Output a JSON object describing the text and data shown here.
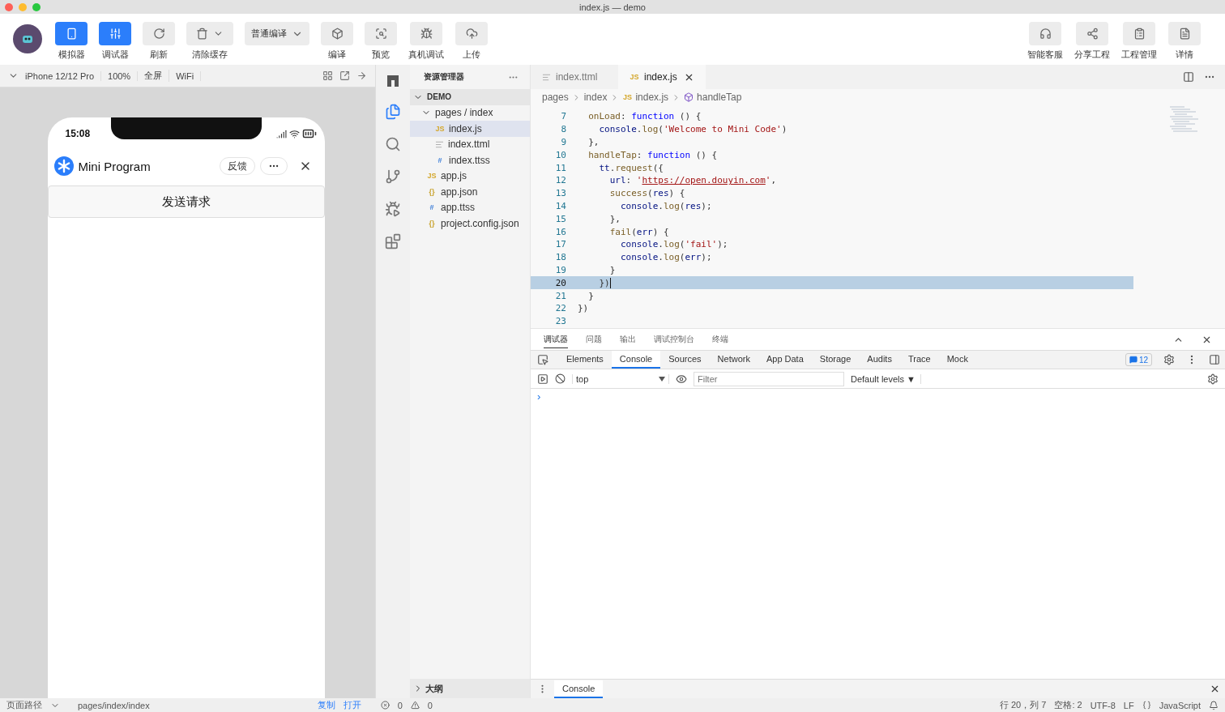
{
  "window": {
    "title": "index.js — demo"
  },
  "toolbar": {
    "left": [
      {
        "label": "模拟器",
        "active": true
      },
      {
        "label": "调试器",
        "active": true
      },
      {
        "label": "刷新",
        "active": false
      },
      {
        "label": "清除缓存",
        "active": false,
        "dropdown": true
      },
      {
        "kind": "select",
        "label": "普通编译"
      },
      {
        "label": "编译",
        "active": false
      },
      {
        "label": "预览",
        "active": false
      },
      {
        "label": "真机调试",
        "active": false
      },
      {
        "label": "上传",
        "active": false
      }
    ],
    "right": [
      {
        "label": "智能客服"
      },
      {
        "label": "分享工程"
      },
      {
        "label": "工程管理"
      },
      {
        "label": "详情"
      }
    ]
  },
  "device_bar": {
    "device": "iPhone 12/12 Pro",
    "zoom": "100%",
    "mode": "全屏",
    "network": "WiFi"
  },
  "phone": {
    "time": "15:08",
    "app_name": "Mini Program",
    "feedback": "反馈",
    "button": "发送请求"
  },
  "explorer": {
    "title": "资源管理器",
    "root": {
      "label": "DEMO",
      "expanded": true,
      "children": [
        {
          "label": "pages / index",
          "kind": "folder",
          "expanded": true,
          "children": [
            {
              "label": "index.js",
              "kind": "js",
              "glyph": "JS",
              "selected": true
            },
            {
              "label": "index.ttml",
              "kind": "ttml",
              "selected": false
            },
            {
              "label": "index.ttss",
              "kind": "ttss",
              "glyph": "#",
              "selected": false
            }
          ]
        },
        {
          "label": "app.js",
          "kind": "js",
          "glyph": "JS",
          "selected": false
        },
        {
          "label": "app.json",
          "kind": "json",
          "glyph": "{}",
          "selected": false
        },
        {
          "label": "app.ttss",
          "kind": "ttss",
          "glyph": "#",
          "selected": false
        },
        {
          "label": "project.config.json",
          "kind": "json",
          "glyph": "{}",
          "selected": false
        }
      ]
    },
    "outline": {
      "label": "大纲",
      "expanded": false
    }
  },
  "editor": {
    "tabs": [
      {
        "label": "index.ttml",
        "kind": "ttml",
        "selected": false
      },
      {
        "label": "index.js",
        "kind": "js",
        "glyph": "JS",
        "selected": true
      }
    ],
    "breadcrumbs": [
      {
        "label": "pages"
      },
      {
        "label": "index"
      },
      {
        "label": "index.js",
        "glyph": "JS"
      },
      {
        "label": "handleTap"
      }
    ],
    "lines": [
      {
        "number": "7",
        "selected": false,
        "tokens": [
          {
            "text": "  onLoad",
            "kind": "fn"
          },
          {
            "text": ": ",
            "kind": "p"
          },
          {
            "text": "function",
            "kind": "kw"
          },
          {
            "text": " () {",
            "kind": "p"
          }
        ]
      },
      {
        "number": "8",
        "selected": false,
        "tokens": [
          {
            "text": "    console",
            "kind": "var"
          },
          {
            "text": ".",
            "kind": "p"
          },
          {
            "text": "log",
            "kind": "fn"
          },
          {
            "text": "(",
            "kind": "p"
          },
          {
            "text": "'Welcome to Mini Code'",
            "kind": "str"
          },
          {
            "text": ")",
            "kind": "p"
          }
        ]
      },
      {
        "number": "9",
        "selected": false,
        "tokens": [
          {
            "text": "  },",
            "kind": "p"
          }
        ]
      },
      {
        "number": "10",
        "selected": false,
        "tokens": [
          {
            "text": "  handleTap",
            "kind": "fn"
          },
          {
            "text": ": ",
            "kind": "p"
          },
          {
            "text": "function",
            "kind": "kw"
          },
          {
            "text": " () {",
            "kind": "p"
          }
        ]
      },
      {
        "number": "11",
        "selected": false,
        "tokens": [
          {
            "text": "    tt",
            "kind": "var"
          },
          {
            "text": ".",
            "kind": "p"
          },
          {
            "text": "request",
            "kind": "fn"
          },
          {
            "text": "({",
            "kind": "p"
          }
        ]
      },
      {
        "number": "12",
        "selected": false,
        "tokens": [
          {
            "text": "      url",
            "kind": "var"
          },
          {
            "text": ": ",
            "kind": "p"
          },
          {
            "text": "'",
            "kind": "str"
          },
          {
            "text": "https://open.douyin.com",
            "kind": "url"
          },
          {
            "text": "'",
            "kind": "str"
          },
          {
            "text": ",",
            "kind": "p"
          }
        ]
      },
      {
        "number": "13",
        "selected": false,
        "tokens": [
          {
            "text": "      success",
            "kind": "fn"
          },
          {
            "text": "(",
            "kind": "p"
          },
          {
            "text": "res",
            "kind": "var"
          },
          {
            "text": ") {",
            "kind": "p"
          }
        ]
      },
      {
        "number": "14",
        "selected": false,
        "tokens": [
          {
            "text": "        console",
            "kind": "var"
          },
          {
            "text": ".",
            "kind": "p"
          },
          {
            "text": "log",
            "kind": "fn"
          },
          {
            "text": "(",
            "kind": "p"
          },
          {
            "text": "res",
            "kind": "var"
          },
          {
            "text": ");",
            "kind": "p"
          }
        ]
      },
      {
        "number": "15",
        "selected": false,
        "tokens": [
          {
            "text": "      },",
            "kind": "p"
          }
        ]
      },
      {
        "number": "16",
        "selected": false,
        "tokens": [
          {
            "text": "      fail",
            "kind": "fn"
          },
          {
            "text": "(",
            "kind": "p"
          },
          {
            "text": "err",
            "kind": "var"
          },
          {
            "text": ") {",
            "kind": "p"
          }
        ]
      },
      {
        "number": "17",
        "selected": false,
        "tokens": [
          {
            "text": "        console",
            "kind": "var"
          },
          {
            "text": ".",
            "kind": "p"
          },
          {
            "text": "log",
            "kind": "fn"
          },
          {
            "text": "(",
            "kind": "p"
          },
          {
            "text": "'fail'",
            "kind": "str"
          },
          {
            "text": ");",
            "kind": "p"
          }
        ]
      },
      {
        "number": "18",
        "selected": false,
        "tokens": [
          {
            "text": "        console",
            "kind": "var"
          },
          {
            "text": ".",
            "kind": "p"
          },
          {
            "text": "log",
            "kind": "fn"
          },
          {
            "text": "(",
            "kind": "p"
          },
          {
            "text": "err",
            "kind": "var"
          },
          {
            "text": ");",
            "kind": "p"
          }
        ]
      },
      {
        "number": "19",
        "selected": false,
        "tokens": [
          {
            "text": "      }",
            "kind": "p"
          }
        ]
      },
      {
        "number": "20",
        "selected": true,
        "tokens": [
          {
            "text": "    })",
            "kind": "p"
          }
        ]
      },
      {
        "number": "21",
        "selected": false,
        "tokens": [
          {
            "text": "  }",
            "kind": "p"
          }
        ]
      },
      {
        "number": "22",
        "selected": false,
        "tokens": [
          {
            "text": "})",
            "kind": "p"
          }
        ]
      },
      {
        "number": "23",
        "selected": false
      }
    ]
  },
  "debugger": {
    "tabs": [
      {
        "label": "调试器",
        "selected": true
      },
      {
        "label": "问题",
        "selected": false
      },
      {
        "label": "输出",
        "selected": false
      },
      {
        "label": "调试控制台",
        "selected": false
      },
      {
        "label": "终端",
        "selected": false
      }
    ],
    "devtools_tabs": [
      {
        "label": "Elements",
        "selected": false
      },
      {
        "label": "Console",
        "selected": true
      },
      {
        "label": "Sources",
        "selected": false
      },
      {
        "label": "Network",
        "selected": false
      },
      {
        "label": "App Data",
        "selected": false
      },
      {
        "label": "Storage",
        "selected": false
      },
      {
        "label": "Audits",
        "selected": false
      },
      {
        "label": "Trace",
        "selected": false
      },
      {
        "label": "Mock",
        "selected": false
      }
    ],
    "message_count": "12",
    "context": "top",
    "filter_placeholder": "Filter",
    "levels": "Default levels ▼",
    "prompt": "›",
    "drawer_tab": "Console"
  },
  "status_bar": {
    "path_label": "页面路径",
    "path": "pages/index/index",
    "copy": "复制",
    "open": "打开",
    "errors": "0",
    "warnings": "0",
    "position": "行 20，列 7",
    "spaces": "空格: 2",
    "encoding": "UTF-8",
    "eol": "LF",
    "language": "JavaScript"
  }
}
